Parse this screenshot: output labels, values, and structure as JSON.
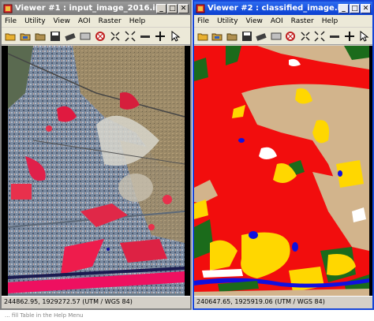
{
  "viewer1": {
    "title": "Viewer #1 : input_image_2016.img (:L...",
    "menu": [
      "File",
      "Utility",
      "View",
      "AOI",
      "Raster",
      "Help"
    ],
    "status": "244862.95, 1929272.57  (UTM / WGS 84)",
    "title_color": "#8a8a8a"
  },
  "viewer2": {
    "title": "Viewer #2 : classified_image.img (:L...",
    "menu": [
      "File",
      "Utility",
      "View",
      "AOI",
      "Raster",
      "Help"
    ],
    "status": "240647.65, 1925919.06  (UTM / WGS 84)",
    "title_color": "#1545d8"
  },
  "title_buttons": {
    "minimize": "_",
    "maximize": "□",
    "close": "✕"
  },
  "toolbar_icons": [
    "open-folder-icon",
    "open-layer-icon",
    "close-layer-icon",
    "save-icon",
    "eraser-icon",
    "clear-view-icon",
    "info-icon",
    "zoom-in-icon",
    "zoom-out-icon",
    "rotate-icon",
    "hand-icon",
    "arrow-icon",
    "inquire-cursor-icon"
  ],
  "classified_palette": {
    "urban": "#f20d0d",
    "bare_soil": "#d2b48c",
    "crop": "#ffd700",
    "vegetation": "#1b6b1b",
    "water": "#1010e0",
    "white": "#ffffff"
  },
  "bottom_caption": "... fill Table in the Help Menu"
}
